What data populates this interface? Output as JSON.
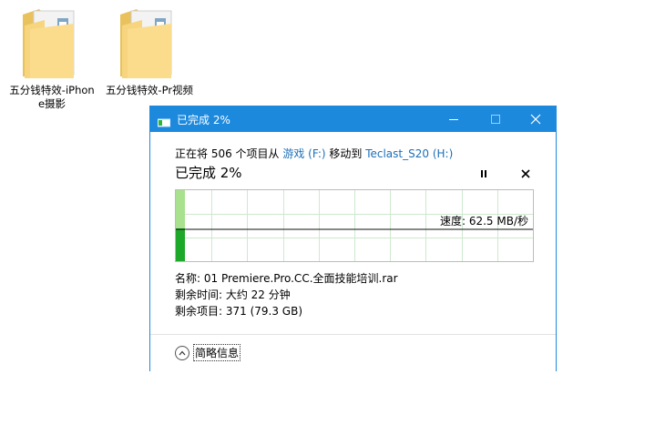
{
  "desktop": {
    "icons": [
      {
        "label": "五分钱特效-iPhone摄影"
      },
      {
        "label": "五分钱特效-Pr视频"
      }
    ]
  },
  "dialog": {
    "title": "已完成 2%",
    "copy": {
      "prefix": "正在将 506 个项目从 ",
      "source": "游戏 (F:)",
      "middle": " 移动到 ",
      "destination": "Teclast_S20 (H:)"
    },
    "progress_title": "已完成 2%",
    "progress_percent": 2,
    "speed": "速度: 62.5 MB/秒",
    "details": {
      "name": "名称: 01 Premiere.Pro.CC.全面技能培训.rar",
      "time_left": "剩余时间: 大约 22 分钟",
      "items_left": "剩余项目: 371 (79.3 GB)"
    },
    "more_info_label": "简略信息"
  },
  "colors": {
    "titlebar": "#1c89dd",
    "link": "#1c6fb8",
    "progress_fill": "#a9e28f",
    "progress_dark": "#1ea82a"
  }
}
